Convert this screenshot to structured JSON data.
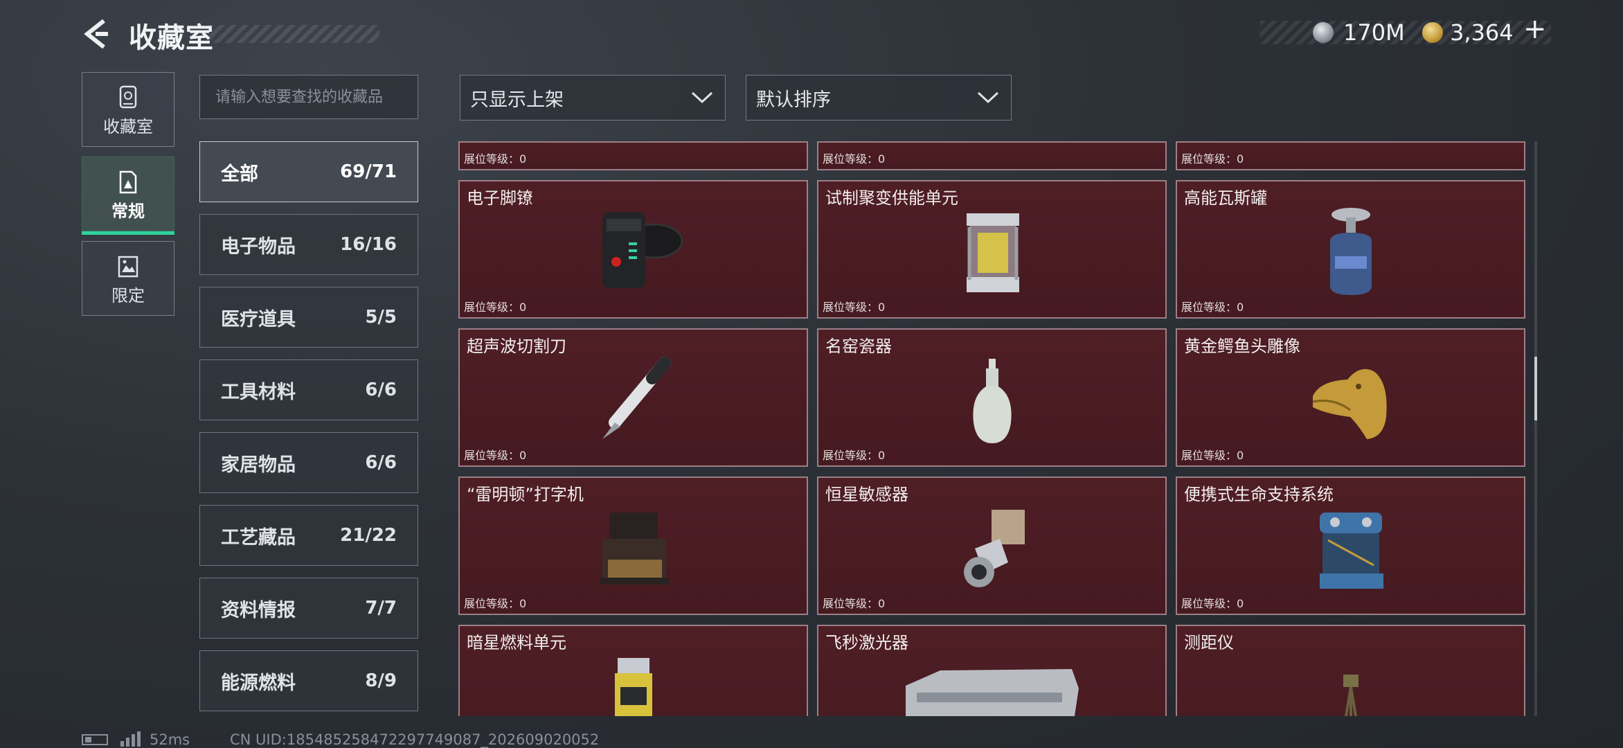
{
  "header": {
    "title": "收藏室",
    "currency_silver": "170M",
    "currency_gold": "3,364",
    "add_symbol": "+"
  },
  "modes": [
    {
      "label": "收藏室",
      "icon": "collection-room-icon"
    },
    {
      "label": "常规",
      "icon": "regular-icon",
      "active": true
    },
    {
      "label": "限定",
      "icon": "limited-icon"
    }
  ],
  "search": {
    "placeholder": "请输入想要查找的收藏品",
    "value": ""
  },
  "categories": [
    {
      "label": "全部",
      "count": "69/71",
      "active": true
    },
    {
      "label": "电子物品",
      "count": "16/16"
    },
    {
      "label": "医疗道具",
      "count": "5/5"
    },
    {
      "label": "工具材料",
      "count": "6/6"
    },
    {
      "label": "家居物品",
      "count": "6/6"
    },
    {
      "label": "工艺藏品",
      "count": "21/22"
    },
    {
      "label": "资料情报",
      "count": "7/7"
    },
    {
      "label": "能源燃料",
      "count": "8/9"
    }
  ],
  "filters": {
    "filter_label": "只显示上架",
    "sort_label": "默认排序"
  },
  "level_label": "展位等级：0",
  "items": [
    {
      "name": "电子脚镣",
      "icon": "electronic-shackle-icon"
    },
    {
      "name": "试制聚变供能单元",
      "icon": "fusion-power-unit-icon"
    },
    {
      "name": "高能瓦斯罐",
      "icon": "gas-canister-icon"
    },
    {
      "name": "超声波切割刀",
      "icon": "ultrasonic-cutter-icon"
    },
    {
      "name": "名窑瓷器",
      "icon": "porcelain-vase-icon"
    },
    {
      "name": "黄金鳄鱼头雕像",
      "icon": "golden-crocodile-head-icon"
    },
    {
      "name": "“雷明顿”打字机",
      "icon": "typewriter-icon"
    },
    {
      "name": "恒星敏感器",
      "icon": "star-sensor-icon"
    },
    {
      "name": "便携式生命支持系统",
      "icon": "life-support-system-icon"
    },
    {
      "name": "暗星燃料单元",
      "icon": "fuel-cell-icon"
    },
    {
      "name": "飞秒激光器",
      "icon": "femtosecond-laser-icon"
    },
    {
      "name": "测距仪",
      "icon": "rangefinder-icon"
    }
  ],
  "colors": {
    "card_bg": "#4a1c22",
    "accent": "#2fd39a",
    "gold": "#c49a3a"
  },
  "status": {
    "ping": "52ms",
    "uid": "CN UID:185485258472297749087_202609020052"
  }
}
